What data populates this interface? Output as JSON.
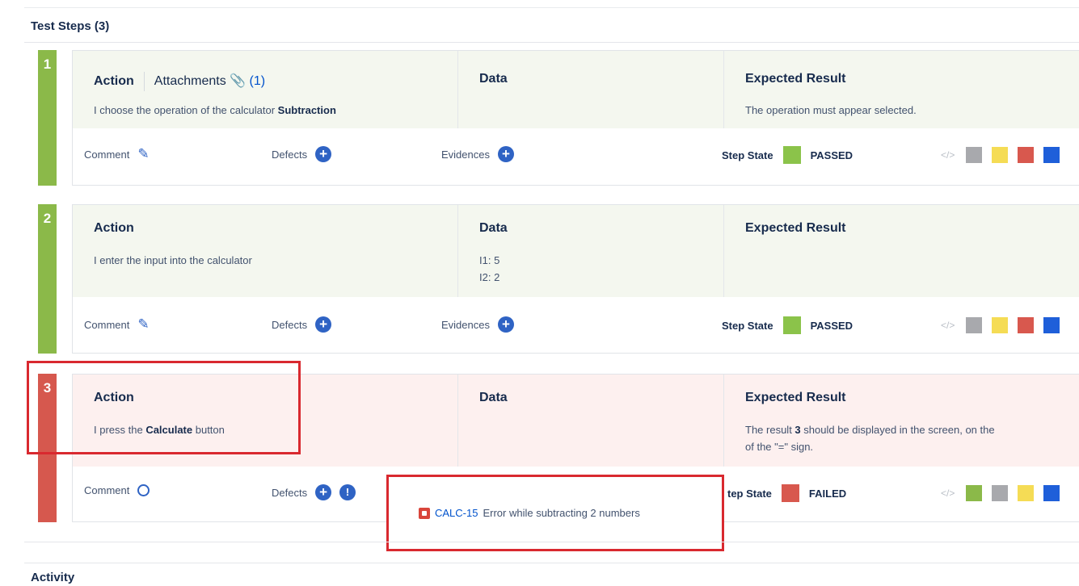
{
  "title": "Test Steps (3)",
  "activity_title": "Activity",
  "labels": {
    "action": "Action",
    "attachments": "Attachments",
    "attachments_count": "(1)",
    "data": "Data",
    "expected": "Expected Result",
    "comment": "Comment",
    "defects": "Defects",
    "evidences": "Evidences",
    "step_state": "Step State",
    "step_state_partial": "tep State"
  },
  "steps": [
    {
      "number": "1",
      "color": "#8bb949",
      "action_pre": "I choose the operation of the calculator ",
      "action_bold": "Subtraction",
      "data_lines": [],
      "expected_pre": "The operation must appear selected.",
      "state": "PASSED",
      "state_color": "#8bc34a",
      "swatches": [
        "#a8a9ad",
        "#f5dc55",
        "#d8584e",
        "#1f5fd9"
      ]
    },
    {
      "number": "2",
      "color": "#8bb949",
      "action_pre": "I enter the input into the calculator",
      "data_lines": [
        "I1: 5",
        "I2: 2"
      ],
      "state": "PASSED",
      "state_color": "#8bc34a",
      "swatches": [
        "#a8a9ad",
        "#f5dc55",
        "#d8584e",
        "#1f5fd9"
      ]
    },
    {
      "number": "3",
      "color": "#d6584e",
      "action_pre": "I press the ",
      "action_bold": "Calculate",
      "action_post": " button",
      "expected_pre": "The result ",
      "expected_bold": "3",
      "expected_post": " should be displayed in the screen, on the",
      "expected_line2": "of the \"=\" sign.",
      "state": "FAILED",
      "state_color": "#d8584e",
      "swatches": [
        "#8bb949",
        "#a8a9ad",
        "#f5dc55",
        "#1f5fd9"
      ]
    }
  ],
  "defect": {
    "key": "CALC-15",
    "summary": "Error while subtracting 2 numbers"
  },
  "colors": {
    "passed_step": "#8bb949",
    "failed_step": "#d6584e",
    "highlight": "#d9292f",
    "link": "#0052cc"
  }
}
